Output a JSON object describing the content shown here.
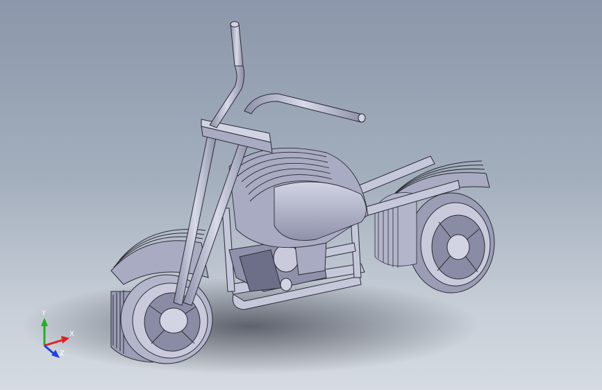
{
  "viewport": {
    "model_name": "motorcycle"
  },
  "triad": {
    "x_label": "X",
    "y_label": "Y",
    "z_label": "Z",
    "x_color": "#e02020",
    "y_color": "#20b020",
    "z_color": "#2040e0"
  },
  "colors": {
    "part_light": "#c9cbdd",
    "part_mid": "#a9abc2",
    "part_dark": "#6d6f88",
    "edge": "#2a2a33"
  }
}
